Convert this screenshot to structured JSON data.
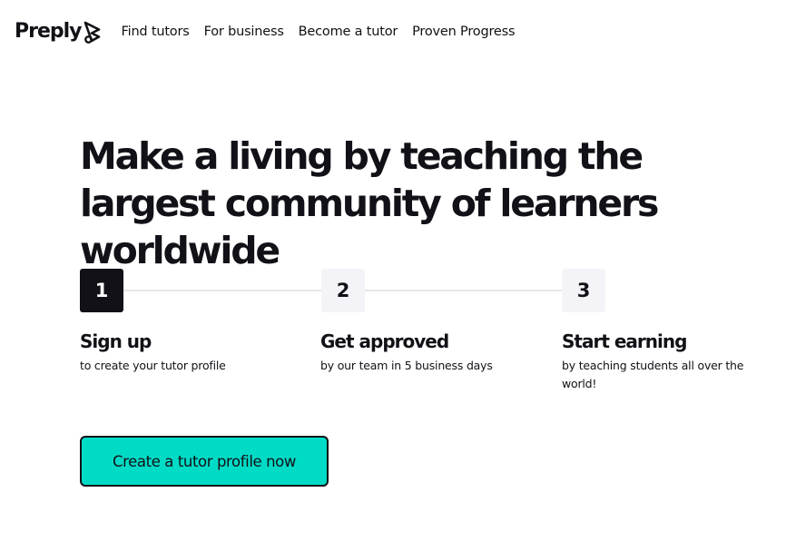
{
  "header": {
    "logo_text": "Preply",
    "nav": [
      {
        "label": "Find tutors"
      },
      {
        "label": "For business"
      },
      {
        "label": "Become a tutor"
      },
      {
        "label": "Proven Progress"
      }
    ]
  },
  "hero": {
    "title": "Make a living by teaching the largest community of learners worldwide"
  },
  "steps": [
    {
      "number": "1",
      "title": "Sign up",
      "description": "to create your tutor profile",
      "active": true
    },
    {
      "number": "2",
      "title": "Get approved",
      "description": "by our team in 5 business days",
      "active": false
    },
    {
      "number": "3",
      "title": "Start earning",
      "description": "by teaching students all over the world!",
      "active": false
    }
  ],
  "cta": {
    "label": "Create a tutor profile now"
  },
  "colors": {
    "accent": "#00dbc6",
    "text": "#121117",
    "step_idle_bg": "#f4f4f8",
    "connector": "#e6e6ea"
  }
}
